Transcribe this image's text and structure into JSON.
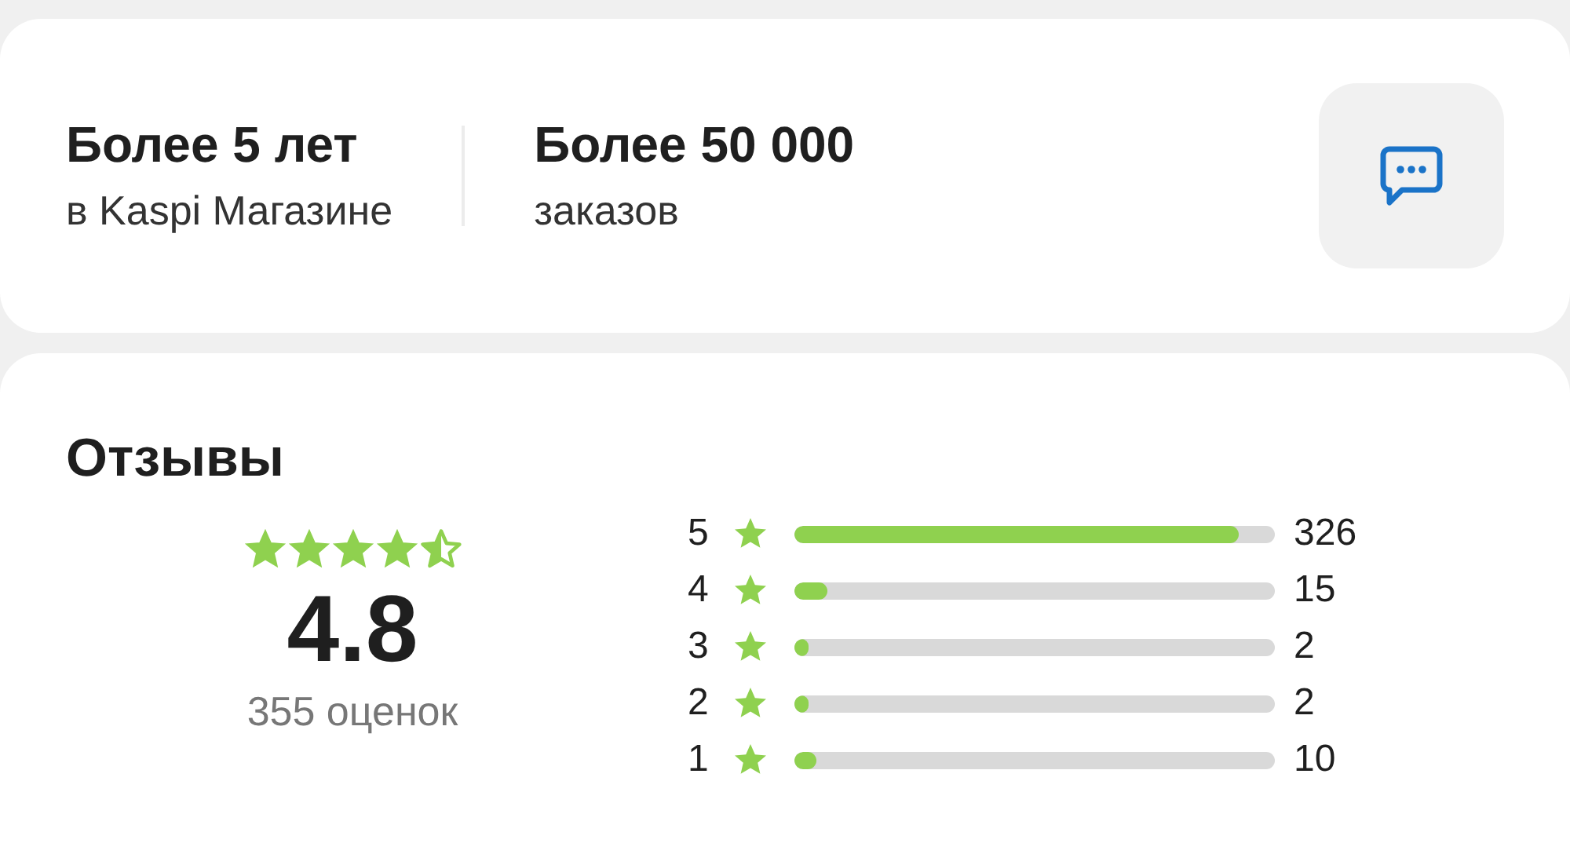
{
  "stats": [
    {
      "title": "Более 5 лет",
      "subtitle": "в Kaspi Магазине"
    },
    {
      "title": "Более 50 000",
      "subtitle": "заказов"
    }
  ],
  "chat_button": {
    "kind": "chat"
  },
  "reviews": {
    "title": "Отзывы",
    "stars": 4.5,
    "rating": "4.8",
    "count": "355 оценок",
    "breakdown": [
      {
        "label": "5",
        "level": 0.925,
        "count": "326"
      },
      {
        "label": "4",
        "level": 0.07,
        "count": "15"
      },
      {
        "label": "3",
        "level": 0.025,
        "count": "2"
      },
      {
        "label": "2",
        "level": 0.025,
        "count": "2"
      },
      {
        "label": "1",
        "level": 0.045,
        "count": "10"
      }
    ]
  }
}
